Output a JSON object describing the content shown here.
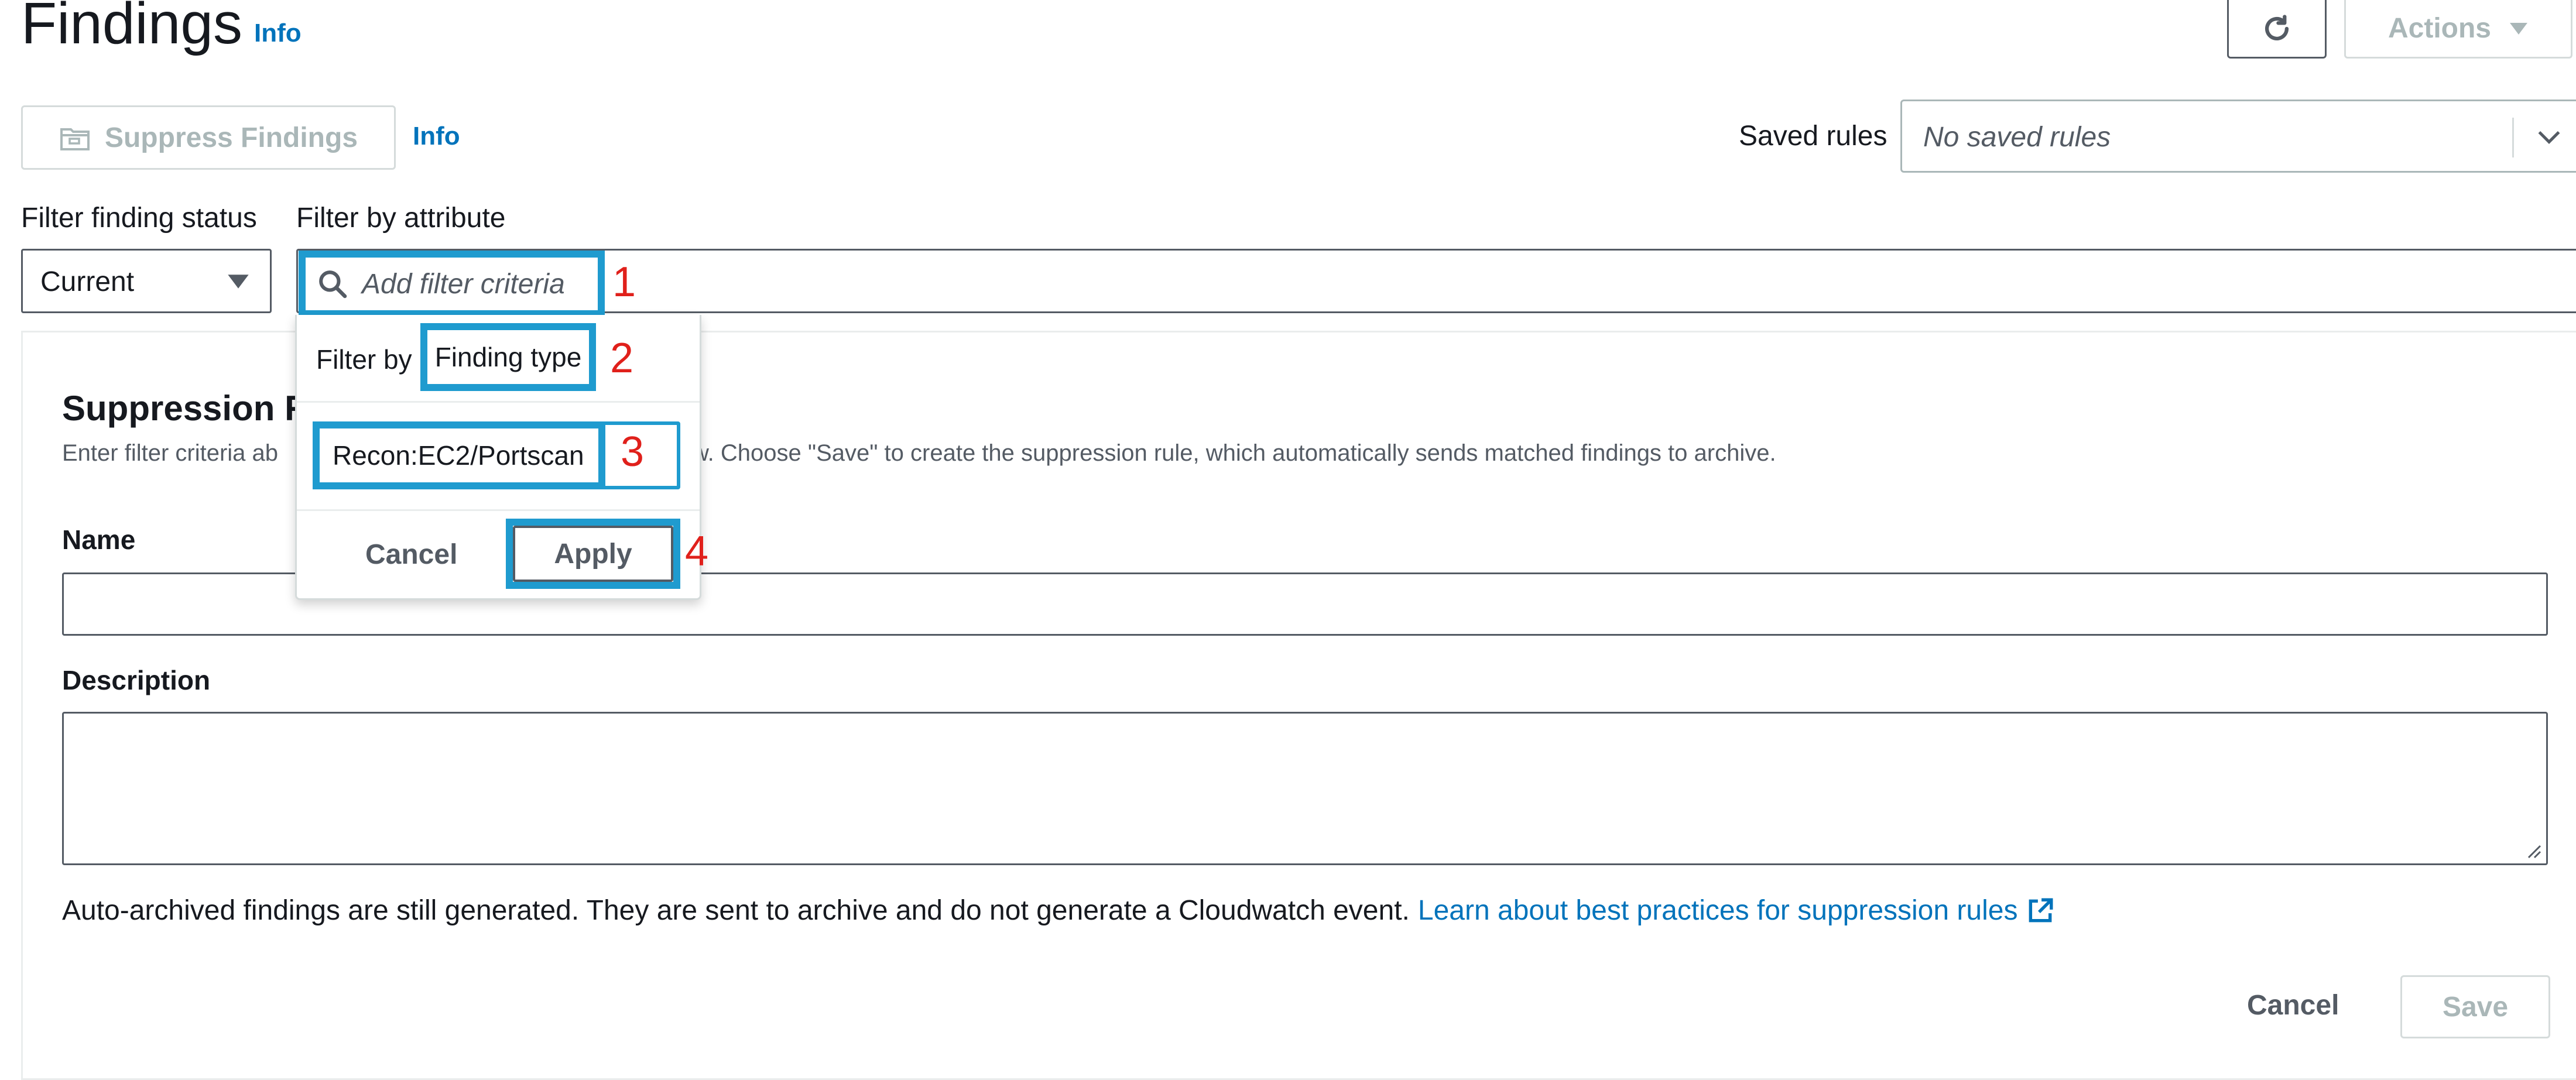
{
  "header": {
    "title": "Findings",
    "info": "Info",
    "actions_label": "Actions",
    "icons": {
      "refresh": "refresh-icon",
      "actions_caret": "caret-down-icon"
    }
  },
  "toolbar": {
    "suppress_label": "Suppress Findings",
    "suppress_icon": "folder-archive-icon",
    "info": "Info",
    "saved_rules_label": "Saved rules",
    "saved_rules_placeholder": "No saved rules"
  },
  "filters": {
    "status_label": "Filter finding status",
    "status_value": "Current",
    "attribute_label": "Filter by attribute",
    "attribute_placeholder": "Add filter criteria"
  },
  "dropdown": {
    "filter_by_prefix": "Filter by",
    "attribute_name": "Finding type",
    "value": "Recon:EC2/Portscan",
    "cancel_label": "Cancel",
    "apply_label": "Apply"
  },
  "annotations": {
    "n1": "1",
    "n2": "2",
    "n3": "3",
    "n4": "4"
  },
  "panel": {
    "title": "Suppression R",
    "description": "Enter filter criteria ab                                          the table below. Choose \"Save\" to create the suppression rule, which automatically sends matched findings to archive.",
    "name_label": "Name",
    "description_label": "Description",
    "note_text": "Auto-archived findings are still generated. They are sent to archive and do not generate a Cloudwatch event.",
    "note_link": "Learn about best practices for suppression rules",
    "cancel_label": "Cancel",
    "save_label": "Save"
  },
  "colors": {
    "highlight": "#1f9bcf",
    "annotation_number": "#e0201b",
    "link": "#0073bb",
    "disabled_text": "#aab7b8"
  }
}
